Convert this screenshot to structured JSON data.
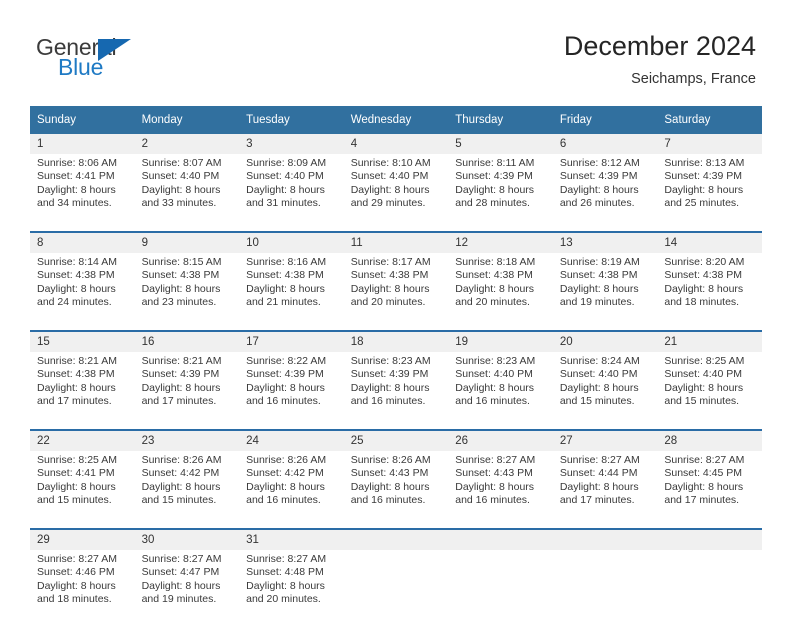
{
  "brand": {
    "name_top": "General",
    "name_bottom": "Blue",
    "flag_icon": "triangle-flag-icon",
    "color_blue": "#1f7ac4",
    "color_flag": "#1668b0"
  },
  "header": {
    "title": "December 2024",
    "subtitle": "Seichamps, France"
  },
  "theme": {
    "header_bg": "#31709f",
    "daynum_bg": "#f0f0f0",
    "row_divider": "#2a6ca6"
  },
  "calendar": {
    "weekday_headers": [
      "Sunday",
      "Monday",
      "Tuesday",
      "Wednesday",
      "Thursday",
      "Friday",
      "Saturday"
    ],
    "weeks": [
      [
        {
          "day": "1",
          "sunrise": "Sunrise: 8:06 AM",
          "sunset": "Sunset: 4:41 PM",
          "daylight_1": "Daylight: 8 hours",
          "daylight_2": "and 34 minutes."
        },
        {
          "day": "2",
          "sunrise": "Sunrise: 8:07 AM",
          "sunset": "Sunset: 4:40 PM",
          "daylight_1": "Daylight: 8 hours",
          "daylight_2": "and 33 minutes."
        },
        {
          "day": "3",
          "sunrise": "Sunrise: 8:09 AM",
          "sunset": "Sunset: 4:40 PM",
          "daylight_1": "Daylight: 8 hours",
          "daylight_2": "and 31 minutes."
        },
        {
          "day": "4",
          "sunrise": "Sunrise: 8:10 AM",
          "sunset": "Sunset: 4:40 PM",
          "daylight_1": "Daylight: 8 hours",
          "daylight_2": "and 29 minutes."
        },
        {
          "day": "5",
          "sunrise": "Sunrise: 8:11 AM",
          "sunset": "Sunset: 4:39 PM",
          "daylight_1": "Daylight: 8 hours",
          "daylight_2": "and 28 minutes."
        },
        {
          "day": "6",
          "sunrise": "Sunrise: 8:12 AM",
          "sunset": "Sunset: 4:39 PM",
          "daylight_1": "Daylight: 8 hours",
          "daylight_2": "and 26 minutes."
        },
        {
          "day": "7",
          "sunrise": "Sunrise: 8:13 AM",
          "sunset": "Sunset: 4:39 PM",
          "daylight_1": "Daylight: 8 hours",
          "daylight_2": "and 25 minutes."
        }
      ],
      [
        {
          "day": "8",
          "sunrise": "Sunrise: 8:14 AM",
          "sunset": "Sunset: 4:38 PM",
          "daylight_1": "Daylight: 8 hours",
          "daylight_2": "and 24 minutes."
        },
        {
          "day": "9",
          "sunrise": "Sunrise: 8:15 AM",
          "sunset": "Sunset: 4:38 PM",
          "daylight_1": "Daylight: 8 hours",
          "daylight_2": "and 23 minutes."
        },
        {
          "day": "10",
          "sunrise": "Sunrise: 8:16 AM",
          "sunset": "Sunset: 4:38 PM",
          "daylight_1": "Daylight: 8 hours",
          "daylight_2": "and 21 minutes."
        },
        {
          "day": "11",
          "sunrise": "Sunrise: 8:17 AM",
          "sunset": "Sunset: 4:38 PM",
          "daylight_1": "Daylight: 8 hours",
          "daylight_2": "and 20 minutes."
        },
        {
          "day": "12",
          "sunrise": "Sunrise: 8:18 AM",
          "sunset": "Sunset: 4:38 PM",
          "daylight_1": "Daylight: 8 hours",
          "daylight_2": "and 20 minutes."
        },
        {
          "day": "13",
          "sunrise": "Sunrise: 8:19 AM",
          "sunset": "Sunset: 4:38 PM",
          "daylight_1": "Daylight: 8 hours",
          "daylight_2": "and 19 minutes."
        },
        {
          "day": "14",
          "sunrise": "Sunrise: 8:20 AM",
          "sunset": "Sunset: 4:38 PM",
          "daylight_1": "Daylight: 8 hours",
          "daylight_2": "and 18 minutes."
        }
      ],
      [
        {
          "day": "15",
          "sunrise": "Sunrise: 8:21 AM",
          "sunset": "Sunset: 4:38 PM",
          "daylight_1": "Daylight: 8 hours",
          "daylight_2": "and 17 minutes."
        },
        {
          "day": "16",
          "sunrise": "Sunrise: 8:21 AM",
          "sunset": "Sunset: 4:39 PM",
          "daylight_1": "Daylight: 8 hours",
          "daylight_2": "and 17 minutes."
        },
        {
          "day": "17",
          "sunrise": "Sunrise: 8:22 AM",
          "sunset": "Sunset: 4:39 PM",
          "daylight_1": "Daylight: 8 hours",
          "daylight_2": "and 16 minutes."
        },
        {
          "day": "18",
          "sunrise": "Sunrise: 8:23 AM",
          "sunset": "Sunset: 4:39 PM",
          "daylight_1": "Daylight: 8 hours",
          "daylight_2": "and 16 minutes."
        },
        {
          "day": "19",
          "sunrise": "Sunrise: 8:23 AM",
          "sunset": "Sunset: 4:40 PM",
          "daylight_1": "Daylight: 8 hours",
          "daylight_2": "and 16 minutes."
        },
        {
          "day": "20",
          "sunrise": "Sunrise: 8:24 AM",
          "sunset": "Sunset: 4:40 PM",
          "daylight_1": "Daylight: 8 hours",
          "daylight_2": "and 15 minutes."
        },
        {
          "day": "21",
          "sunrise": "Sunrise: 8:25 AM",
          "sunset": "Sunset: 4:40 PM",
          "daylight_1": "Daylight: 8 hours",
          "daylight_2": "and 15 minutes."
        }
      ],
      [
        {
          "day": "22",
          "sunrise": "Sunrise: 8:25 AM",
          "sunset": "Sunset: 4:41 PM",
          "daylight_1": "Daylight: 8 hours",
          "daylight_2": "and 15 minutes."
        },
        {
          "day": "23",
          "sunrise": "Sunrise: 8:26 AM",
          "sunset": "Sunset: 4:42 PM",
          "daylight_1": "Daylight: 8 hours",
          "daylight_2": "and 15 minutes."
        },
        {
          "day": "24",
          "sunrise": "Sunrise: 8:26 AM",
          "sunset": "Sunset: 4:42 PM",
          "daylight_1": "Daylight: 8 hours",
          "daylight_2": "and 16 minutes."
        },
        {
          "day": "25",
          "sunrise": "Sunrise: 8:26 AM",
          "sunset": "Sunset: 4:43 PM",
          "daylight_1": "Daylight: 8 hours",
          "daylight_2": "and 16 minutes."
        },
        {
          "day": "26",
          "sunrise": "Sunrise: 8:27 AM",
          "sunset": "Sunset: 4:43 PM",
          "daylight_1": "Daylight: 8 hours",
          "daylight_2": "and 16 minutes."
        },
        {
          "day": "27",
          "sunrise": "Sunrise: 8:27 AM",
          "sunset": "Sunset: 4:44 PM",
          "daylight_1": "Daylight: 8 hours",
          "daylight_2": "and 17 minutes."
        },
        {
          "day": "28",
          "sunrise": "Sunrise: 8:27 AM",
          "sunset": "Sunset: 4:45 PM",
          "daylight_1": "Daylight: 8 hours",
          "daylight_2": "and 17 minutes."
        }
      ],
      [
        {
          "day": "29",
          "sunrise": "Sunrise: 8:27 AM",
          "sunset": "Sunset: 4:46 PM",
          "daylight_1": "Daylight: 8 hours",
          "daylight_2": "and 18 minutes."
        },
        {
          "day": "30",
          "sunrise": "Sunrise: 8:27 AM",
          "sunset": "Sunset: 4:47 PM",
          "daylight_1": "Daylight: 8 hours",
          "daylight_2": "and 19 minutes."
        },
        {
          "day": "31",
          "sunrise": "Sunrise: 8:27 AM",
          "sunset": "Sunset: 4:48 PM",
          "daylight_1": "Daylight: 8 hours",
          "daylight_2": "and 20 minutes."
        },
        {
          "day": "",
          "sunrise": "",
          "sunset": "",
          "daylight_1": "",
          "daylight_2": ""
        },
        {
          "day": "",
          "sunrise": "",
          "sunset": "",
          "daylight_1": "",
          "daylight_2": ""
        },
        {
          "day": "",
          "sunrise": "",
          "sunset": "",
          "daylight_1": "",
          "daylight_2": ""
        },
        {
          "day": "",
          "sunrise": "",
          "sunset": "",
          "daylight_1": "",
          "daylight_2": ""
        }
      ]
    ]
  }
}
